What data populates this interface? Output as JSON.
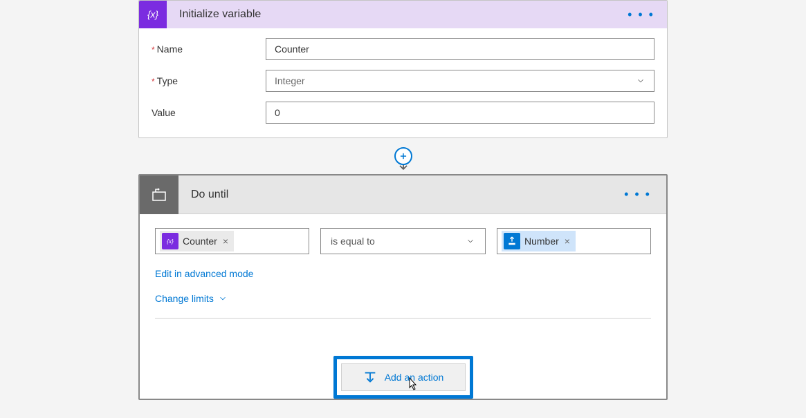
{
  "card1": {
    "title": "Initialize variable",
    "fields": {
      "name_label": "Name",
      "name_value": "Counter",
      "type_label": "Type",
      "type_value": "Integer",
      "value_label": "Value",
      "value_value": "0"
    }
  },
  "card2": {
    "title": "Do until",
    "condition": {
      "left_token": "Counter",
      "operator": "is equal to",
      "right_token": "Number"
    },
    "links": {
      "advanced": "Edit in advanced mode",
      "limits": "Change limits"
    },
    "add_action": "Add an action"
  }
}
